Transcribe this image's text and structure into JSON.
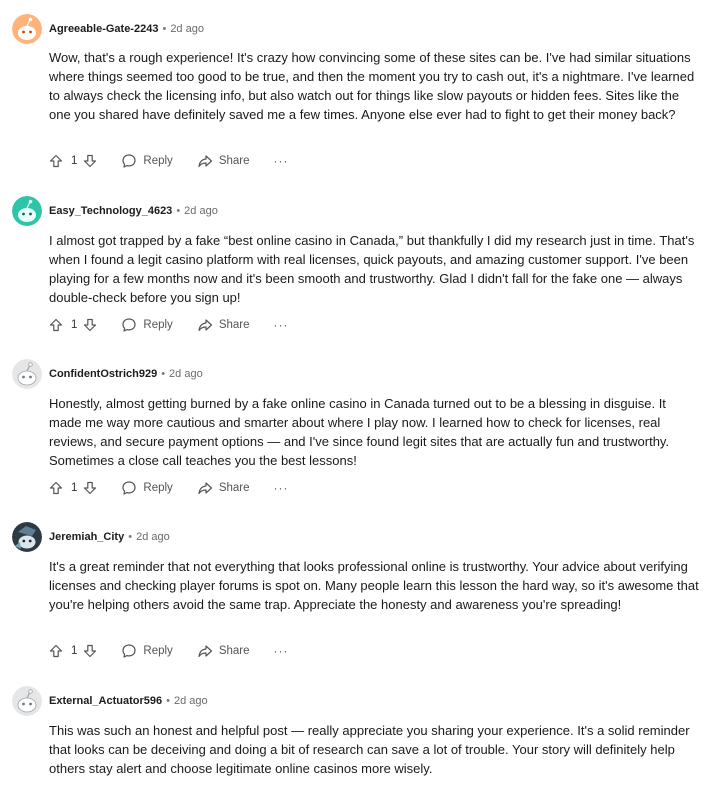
{
  "actions": {
    "reply_label": "Reply",
    "share_label": "Share",
    "more_label": "···"
  },
  "colors": {
    "avatar_orange": "#ffb37a",
    "avatar_teal": "#2ec4a8",
    "avatar_gray": "#e6e6e6",
    "avatar_dark": "#2b3a44"
  },
  "comments": [
    {
      "author": "Agreeable-Gate-2243",
      "age": "2d ago",
      "avatar": "snoo-orange",
      "text": "Wow, that's a rough experience! It's crazy how convincing some of these sites can be. I've had similar situations where things seemed too good to be true, and then the moment you try to cash out, it's a nightmare. I've learned to always check the licensing info, but also watch out for things like slow payouts or hidden fees. Sites like the one you shared have definitely saved me a few times. Anyone else ever had to fight to get their money back?",
      "votes": "1"
    },
    {
      "author": "Easy_Technology_4623",
      "age": "2d ago",
      "avatar": "snoo-teal",
      "text": "I almost got trapped by a fake “best online casino in Canada,” but thankfully I did my research just in time. That's when I found a legit casino platform with real licenses, quick payouts, and amazing customer support. I've been playing for a few months now and it's been smooth and trustworthy. Glad I didn't fall for the fake one — always double-check before you sign up!",
      "votes": "1"
    },
    {
      "author": "ConfidentOstrich929",
      "age": "2d ago",
      "avatar": "snoo-gray",
      "text": "Honestly, almost getting burned by a fake online casino in Canada turned out to be a blessing in disguise. It made me way more cautious and smarter about where I play now. I learned how to check for licenses, real reviews, and secure payment options — and I've since found legit sites that are actually fun and trustworthy. Sometimes a close call teaches you the best lessons!",
      "votes": "1"
    },
    {
      "author": "Jeremiah_City",
      "age": "2d ago",
      "avatar": "snoo-dark",
      "text": "It's a great reminder that not everything that looks professional online is trustworthy. Your advice about verifying licenses and checking player forums is spot on. Many people learn this lesson the hard way, so it's awesome that you're helping others avoid the same trap. Appreciate the honesty and awareness you're spreading!",
      "votes": "1"
    },
    {
      "author": "External_Actuator596",
      "age": "2d ago",
      "avatar": "snoo-gray",
      "text": "This was such an honest and helpful post — really appreciate you sharing your experience. It's a solid reminder that looks can be deceiving and doing a bit of research can save a lot of trouble. Your story will definitely help others stay alert and choose legitimate online casinos more wisely.",
      "votes": null
    }
  ]
}
